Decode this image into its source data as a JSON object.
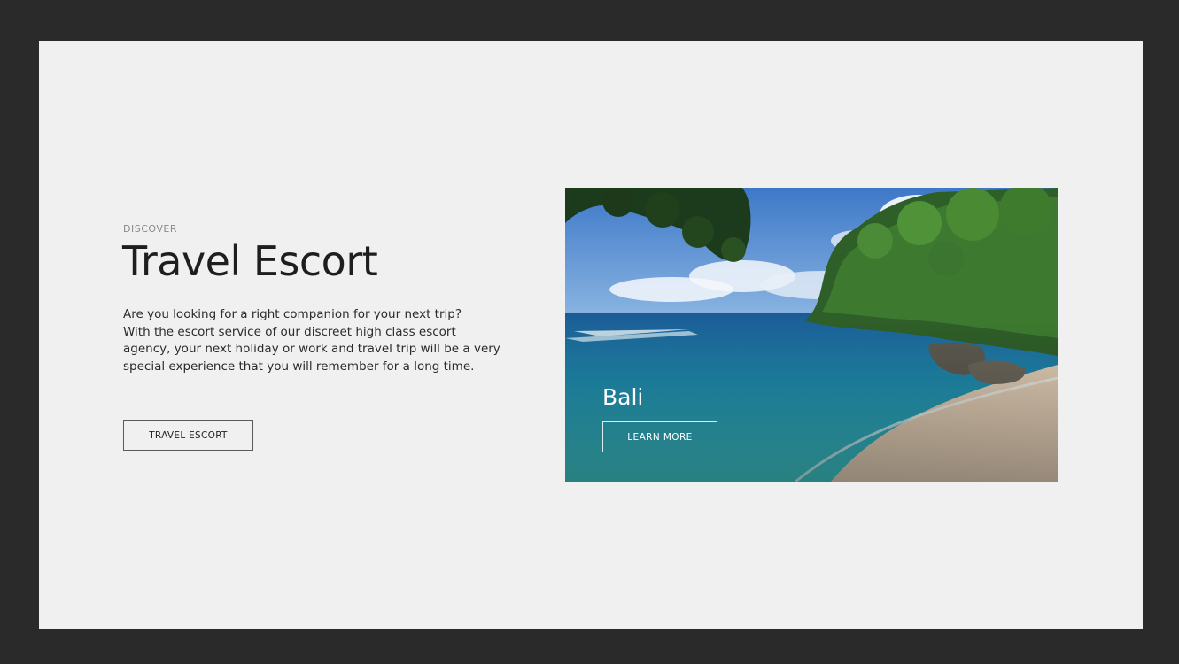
{
  "hero": {
    "eyebrow": "DISCOVER",
    "title": "Travel Escort",
    "description_lines": [
      "Are you looking for a right companion for your next trip?",
      "With the escort service of our discreet high class escort",
      "agency, your next holiday or work and travel trip will be a very",
      "special experience that you will remember for a long time."
    ],
    "button_label": "TRAVEL ESCORT"
  },
  "destination_card": {
    "title": "Bali",
    "button_label": "LEARN MORE",
    "image": "tropical-beach-photo"
  },
  "colors": {
    "outer_background": "#2a2a2a",
    "page_background": "#f0f0f0",
    "text_dark": "#1e1e1e",
    "text_muted": "#8a8a8a"
  }
}
